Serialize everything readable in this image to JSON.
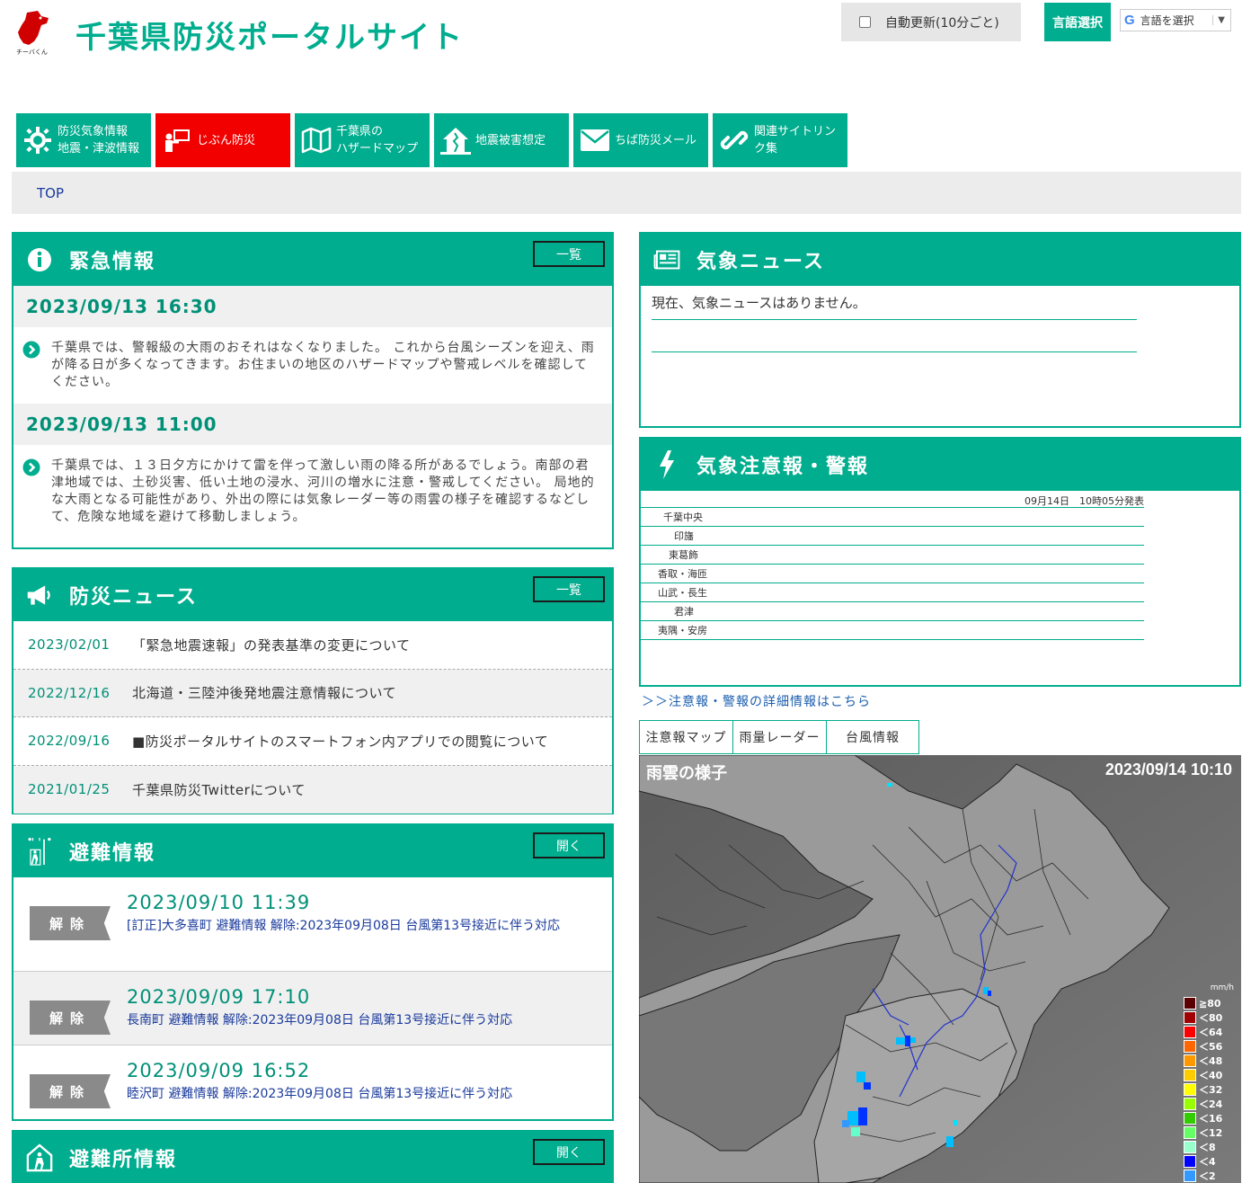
{
  "header": {
    "site_title": "千葉県防災ポータルサイト",
    "logo_caption": "チーバくん",
    "auto_refresh_label": "自動更新(10分ごと)",
    "lang_label": "言語選択",
    "lang_select_value": "言語を選択"
  },
  "nav": [
    {
      "label": "防災気象情報\n地震・津波情報",
      "icon": "gear-icon"
    },
    {
      "label": "じぶん防災",
      "icon": "person-board-icon"
    },
    {
      "label": "千葉県の\nハザードマップ",
      "icon": "map-icon"
    },
    {
      "label": "地震被害想定",
      "icon": "damaged-house-icon"
    },
    {
      "label": "ちば防災メール",
      "icon": "mail-icon"
    },
    {
      "label": "関連サイトリン\nク集",
      "icon": "link-icon"
    }
  ],
  "breadcrumb": "TOP",
  "emergency": {
    "title": "緊急情報",
    "button": "一覧",
    "items": [
      {
        "date": "2023/09/13 16:30",
        "text": "千葉県では、警報級の大雨のおそれはなくなりました。 これから台風シーズンを迎え、雨が降る日が多くなってきます。お住まいの地区のハザードマップや警戒レベルを確認してください。"
      },
      {
        "date": "2023/09/13 11:00",
        "text": "千葉県では、１３日夕方にかけて雷を伴って激しい雨の降る所があるでしょう。南部の君津地域では、土砂災害、低い土地の浸水、河川の増水に注意・警戒してください。 局地的な大雨となる可能性があり、外出の際には気象レーダー等の雨雲の様子を確認するなどして、危険な地域を避けて移動しましょう。"
      }
    ]
  },
  "disaster_news": {
    "title": "防災ニュース",
    "button": "一覧",
    "items": [
      {
        "date": "2023/02/01",
        "text": "「緊急地震速報」の発表基準の変更について"
      },
      {
        "date": "2022/12/16",
        "text": "北海道・三陸沖後発地震注意情報について"
      },
      {
        "date": "2022/09/16",
        "text": "■防災ポータルサイトのスマートフォン内アプリでの閲覧について"
      },
      {
        "date": "2021/01/25",
        "text": "千葉県防災Twitterについて"
      }
    ]
  },
  "evacuation": {
    "title": "避難情報",
    "button": "開く",
    "items": [
      {
        "badge": "解除",
        "date": "2023/09/10 11:39",
        "text": "[訂正]大多喜町 避難情報 解除:2023年09月08日 台風第13号接近に伴う対応"
      },
      {
        "badge": "解除",
        "date": "2023/09/09 17:10",
        "text": "長南町 避難情報 解除:2023年09月08日 台風第13号接近に伴う対応"
      },
      {
        "badge": "解除",
        "date": "2023/09/09 16:52",
        "text": "睦沢町 避難情報 解除:2023年09月08日 台風第13号接近に伴う対応"
      }
    ]
  },
  "shelter": {
    "title": "避難所情報",
    "button": "開く"
  },
  "weather_news": {
    "title": "気象ニュース",
    "text": "現在、気象ニュースはありません。"
  },
  "warnings": {
    "title": "気象注意報・警報",
    "issued": "09月14日　10時05分発表",
    "regions": [
      "千葉中央",
      "印旛",
      "東葛飾",
      "香取・海匝",
      "山武・長生",
      "君津",
      "夷隅・安房"
    ],
    "detail_link": "＞＞注意報・警報の詳細情報はこちら"
  },
  "tabs": [
    "注意報マップ",
    "雨量レーダー",
    "台風情報"
  ],
  "radar": {
    "title": "雨雲の様子",
    "time": "2023/09/14 10:10",
    "unit": "mm/h",
    "legend": [
      {
        "label": "≧80",
        "color": "#5a0000"
      },
      {
        "label": "＜80",
        "color": "#a00000"
      },
      {
        "label": "＜64",
        "color": "#ff0000"
      },
      {
        "label": "＜56",
        "color": "#ff6600"
      },
      {
        "label": "＜48",
        "color": "#ff9900"
      },
      {
        "label": "＜40",
        "color": "#ffcc00"
      },
      {
        "label": "＜32",
        "color": "#ffff00"
      },
      {
        "label": "＜24",
        "color": "#99ff00"
      },
      {
        "label": "＜16",
        "color": "#33cc00"
      },
      {
        "label": "＜12",
        "color": "#66ff66"
      },
      {
        "label": "＜8",
        "color": "#99ffcc"
      },
      {
        "label": "＜4",
        "color": "#0000ff"
      },
      {
        "label": "＜2",
        "color": "#3399ff"
      }
    ]
  },
  "colors": {
    "brand_green": "#00ad8e",
    "alert_red": "#f20000"
  }
}
